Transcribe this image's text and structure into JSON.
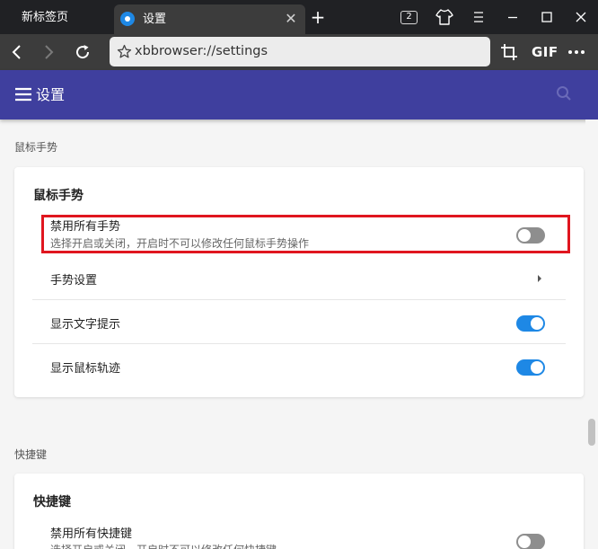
{
  "tabs": [
    {
      "label": "新标签页",
      "active": false
    },
    {
      "label": "设置",
      "active": true
    }
  ],
  "tabbar": {
    "new_tab_symbol": "+",
    "tab_count": "2",
    "close_symbol": "✕"
  },
  "address_bar": {
    "url": "xbbrowser://settings",
    "gif_label": "GIF"
  },
  "header": {
    "title": "设置"
  },
  "mouse_gestures": {
    "section_label": "鼠标手势",
    "card_title": "鼠标手势",
    "disable_all": {
      "title": "禁用所有手势",
      "description": "选择开启或关闭，开启时不可以修改任何鼠标手势操作",
      "enabled": false
    },
    "gesture_settings": {
      "title": "手势设置"
    },
    "show_text_hint": {
      "title": "显示文字提示",
      "enabled": true
    },
    "show_trail": {
      "title": "显示鼠标轨迹",
      "enabled": true
    }
  },
  "shortcuts": {
    "section_label": "快捷键",
    "card_title": "快捷键",
    "disable_all": {
      "title": "禁用所有快捷键",
      "description": "选择开启或关闭，开启时不可以修改任何快捷键",
      "enabled": false
    }
  },
  "colors": {
    "accent": "#1e88e5",
    "header": "#3f3f9e",
    "highlight": "#e0161f",
    "toolbar": "#3c3c3c",
    "tabstrip": "#202124"
  },
  "icons": [
    "tab-favicon-icon",
    "close-icon",
    "plus-icon",
    "tab-count-icon",
    "shirt-icon",
    "hamburger-icon",
    "minimize-icon",
    "maximize-icon",
    "window-close-icon",
    "back-icon",
    "forward-icon",
    "reload-icon",
    "star-icon",
    "crop-icon",
    "more-icon",
    "menu-icon",
    "search-icon",
    "chevron-right-icon"
  ]
}
